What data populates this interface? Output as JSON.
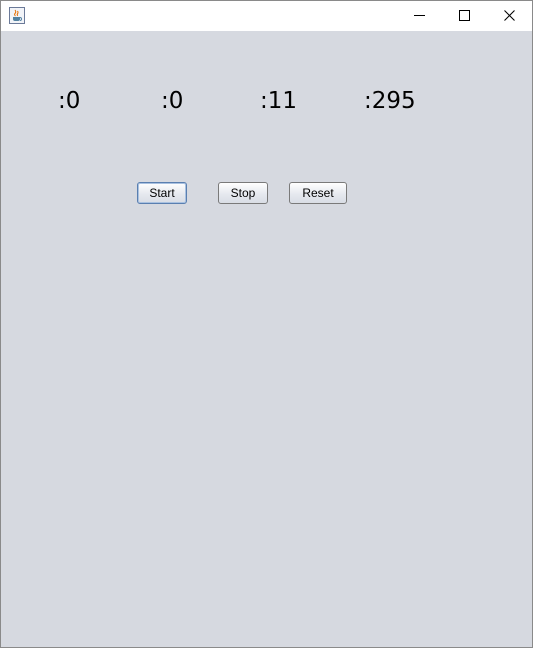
{
  "window": {
    "icon": "java-coffee-cup-icon",
    "controls": [
      "minimize-icon",
      "maximize-icon",
      "close-icon"
    ]
  },
  "timer": {
    "hours": ":0",
    "minutes": ":0",
    "seconds": ":11",
    "milliseconds": ":295"
  },
  "buttons": {
    "start": "Start",
    "stop": "Stop",
    "reset": "Reset"
  },
  "colors": {
    "background": "#d6d9e0",
    "titlebar": "#ffffff",
    "focus_border": "#5a7fb0"
  }
}
